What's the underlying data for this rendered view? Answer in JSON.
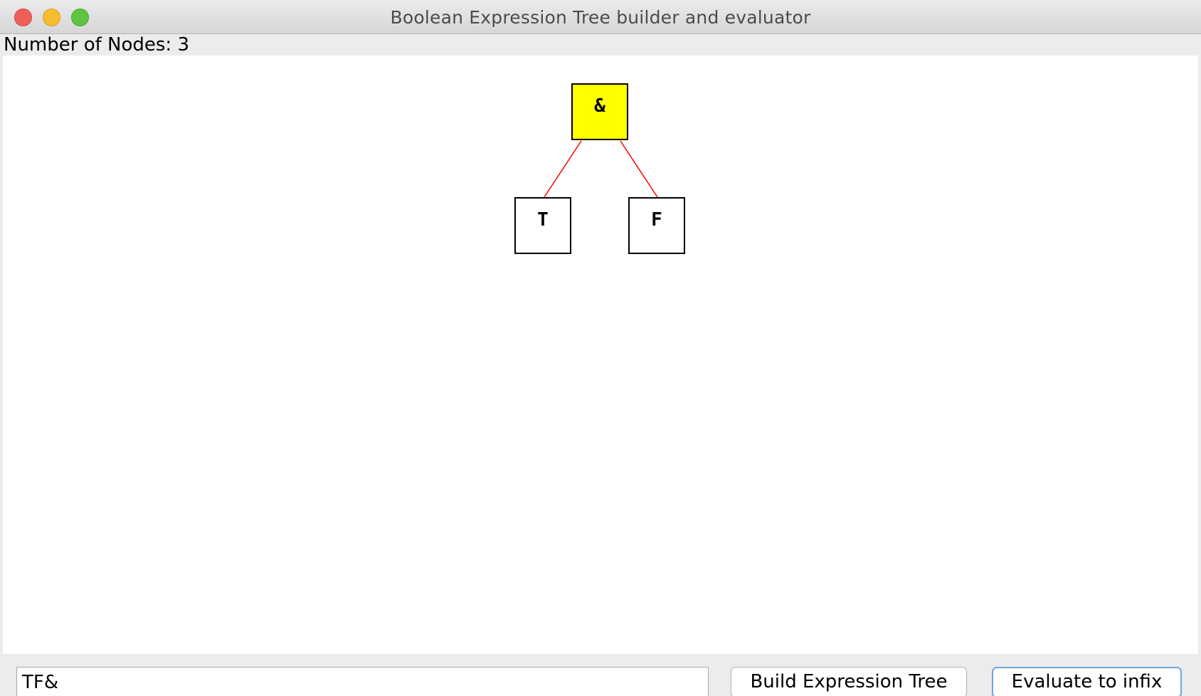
{
  "window": {
    "title": "Boolean Expression Tree builder and evaluator"
  },
  "status": {
    "node_count_label": "Number of Nodes: 3"
  },
  "tree": {
    "root": {
      "label": "&",
      "highlighted": true
    },
    "left": {
      "label": "T",
      "highlighted": false
    },
    "right": {
      "label": "F",
      "highlighted": false
    },
    "edge_color": "#ff0000",
    "highlight_color": "#ffff00"
  },
  "controls": {
    "expression_input_value": "TF&",
    "build_button_label": "Build Expression Tree",
    "evaluate_button_label": "Evaluate to infix"
  }
}
